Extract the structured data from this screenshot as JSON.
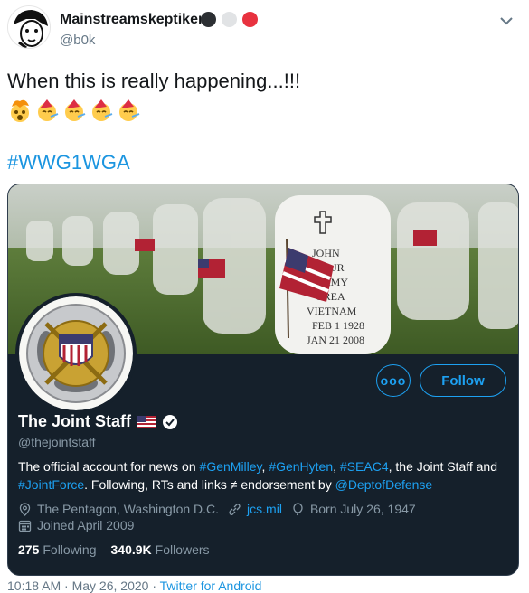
{
  "tweet": {
    "display_name": "Mainstreamskeptiker",
    "handle": "@b0k",
    "name_dots": [
      "#2c2f33",
      "#e1e3e5",
      "#e8323f"
    ],
    "text": "When this is really happening...!!!",
    "emojis": [
      "exploding-head-emoji",
      "partying-face-emoji",
      "partying-face-emoji",
      "partying-face-emoji",
      "partying-face-emoji"
    ],
    "hashtag": "#WWG1WGA",
    "timestamp": "10:18 AM · May 26, 2020 · ",
    "source": "Twitter for Android"
  },
  "card": {
    "more_label": "ooo",
    "follow_label": "Follow",
    "name": "The Joint Staff",
    "handle": "@thejointstaff",
    "bio": {
      "t1": "The official account for news on ",
      "l1": "#GenMilley",
      "t2": ", ",
      "l2": "#GenHyten",
      "t3": ", ",
      "l3": "#SEAC4",
      "t4": ", the Joint Staff and ",
      "l4": "#JointForce",
      "t5": ". Following, RTs and links ≠ endorsement by ",
      "l5": "@DeptofDefense"
    },
    "location": "The Pentagon, Washington D.C.",
    "website": "jcs.mil",
    "born": "Born July 26, 1947",
    "joined": "Joined April 2009",
    "following_count": "275",
    "following_label": "Following",
    "followers_count": "340.9K",
    "followers_label": "Followers",
    "headstone_text": [
      "JOHN",
      "EK JR",
      "ARMY",
      "OREA",
      "VIETNAM",
      "FEB 1 1928",
      "JAN 21 2008"
    ]
  },
  "colors": {
    "link": "#1b95e0",
    "card_bg": "#15202b",
    "accent": "#1da1f2"
  }
}
